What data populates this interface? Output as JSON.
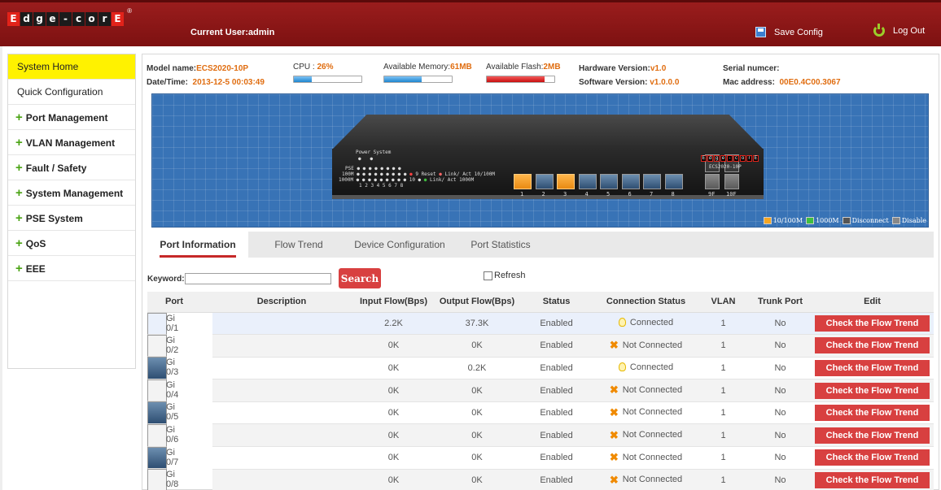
{
  "header": {
    "logo_letters": [
      "E",
      "d",
      "g",
      "e",
      "-",
      "c",
      "o",
      "r",
      "E"
    ],
    "logo_registered": "®",
    "current_user": "Current User:admin",
    "save_config": "Save Config",
    "log_out": "Log Out",
    "colors": {
      "header_bg": "#8a1515",
      "accent": "#d84040",
      "active_menu": "#fff200"
    }
  },
  "sidebar": {
    "items": [
      {
        "label": "System Home",
        "active": true
      },
      {
        "label": "Quick Configuration"
      },
      {
        "label": "Port Management",
        "expandable": true
      },
      {
        "label": "VLAN Management",
        "expandable": true
      },
      {
        "label": "Fault / Safety",
        "expandable": true
      },
      {
        "label": "System Management",
        "expandable": true
      },
      {
        "label": "PSE System",
        "expandable": true
      },
      {
        "label": "QoS",
        "expandable": true
      },
      {
        "label": "EEE",
        "expandable": true
      }
    ],
    "plus": "+"
  },
  "system_info": {
    "model_label": "Model name:",
    "model_value": "ECS2020-10P",
    "datetime_label": "Date/Time:",
    "datetime_value": "2013-12-5 00:03:49",
    "cpu_label": "CPU :",
    "cpu_value": "26%",
    "cpu_fraction": 0.26,
    "memory_label": "Available Memory:",
    "memory_value": "61MB",
    "memory_fraction": 0.55,
    "flash_label": "Available Flash:",
    "flash_value": "2MB",
    "flash_fraction": 0.85,
    "hw_label": "Hardware Version:",
    "hw_value": "v1.0",
    "sw_label": "Software Version:",
    "sw_value": "v1.0.0.0",
    "serial_label": "Serial numcer:",
    "serial_value": "",
    "mac_label": "Mac address:",
    "mac_value": "00E0.4C00.3067"
  },
  "panel": {
    "power_system": "Power System",
    "led_rows": [
      "PSE",
      "100M",
      "1000M"
    ],
    "led_nums": "1 2 3 4 5 6 7 8",
    "reset_line": "9 Reset",
    "ten_line": "10",
    "link_act_100": "Link/ Act 10/100M",
    "link_act_1000": "Link/ Act 1000M",
    "port_numbers": [
      "1",
      "2",
      "3",
      "4",
      "5",
      "6",
      "7",
      "8"
    ],
    "sfp_numbers": [
      "9F",
      "10F"
    ],
    "ports_on": [
      true,
      false,
      true,
      false,
      false,
      false,
      false,
      false
    ],
    "brand_letters": [
      "E",
      "d",
      "g",
      "e",
      "-",
      "c",
      "o",
      "r",
      "E"
    ],
    "model": "ECS2020-10P",
    "legend": [
      {
        "label": "10/100M",
        "color": "#f5a623"
      },
      {
        "label": "1000M",
        "color": "#3fbf3f"
      },
      {
        "label": "Disconnect",
        "color": "#555555"
      },
      {
        "label": "Disable",
        "color": "#888888"
      }
    ]
  },
  "tabs": [
    {
      "label": "Port Information",
      "active": true
    },
    {
      "label": "Flow Trend"
    },
    {
      "label": "Device Configuration"
    },
    {
      "label": "Port Statistics"
    }
  ],
  "search": {
    "keyword_label": "Keyword:",
    "keyword_value": "",
    "button": "Search",
    "refresh_label": "Refresh",
    "refresh_checked": false
  },
  "table": {
    "columns": [
      "Port",
      "Description",
      "Input Flow(Bps)",
      "Output Flow(Bps)",
      "Status",
      "Connection Status",
      "VLAN",
      "Trunk Port",
      "Edit"
    ],
    "edit_button": "Check the Flow Trend",
    "rows": [
      {
        "port": "Gi 0/1",
        "description": "",
        "input": "2.2K",
        "output": "37.3K",
        "status": "Enabled",
        "connection": "Connected",
        "connected": true,
        "vlan": "1",
        "trunk": "No"
      },
      {
        "port": "Gi 0/2",
        "description": "",
        "input": "0K",
        "output": "0K",
        "status": "Enabled",
        "connection": "Not Connected",
        "connected": false,
        "vlan": "1",
        "trunk": "No"
      },
      {
        "port": "Gi 0/3",
        "description": "",
        "input": "0K",
        "output": "0.2K",
        "status": "Enabled",
        "connection": "Connected",
        "connected": true,
        "vlan": "1",
        "trunk": "No"
      },
      {
        "port": "Gi 0/4",
        "description": "",
        "input": "0K",
        "output": "0K",
        "status": "Enabled",
        "connection": "Not Connected",
        "connected": false,
        "vlan": "1",
        "trunk": "No"
      },
      {
        "port": "Gi 0/5",
        "description": "",
        "input": "0K",
        "output": "0K",
        "status": "Enabled",
        "connection": "Not Connected",
        "connected": false,
        "vlan": "1",
        "trunk": "No"
      },
      {
        "port": "Gi 0/6",
        "description": "",
        "input": "0K",
        "output": "0K",
        "status": "Enabled",
        "connection": "Not Connected",
        "connected": false,
        "vlan": "1",
        "trunk": "No"
      },
      {
        "port": "Gi 0/7",
        "description": "",
        "input": "0K",
        "output": "0K",
        "status": "Enabled",
        "connection": "Not Connected",
        "connected": false,
        "vlan": "1",
        "trunk": "No"
      },
      {
        "port": "Gi 0/8",
        "description": "",
        "input": "0K",
        "output": "0K",
        "status": "Enabled",
        "connection": "Not Connected",
        "connected": false,
        "vlan": "1",
        "trunk": "No"
      }
    ]
  }
}
